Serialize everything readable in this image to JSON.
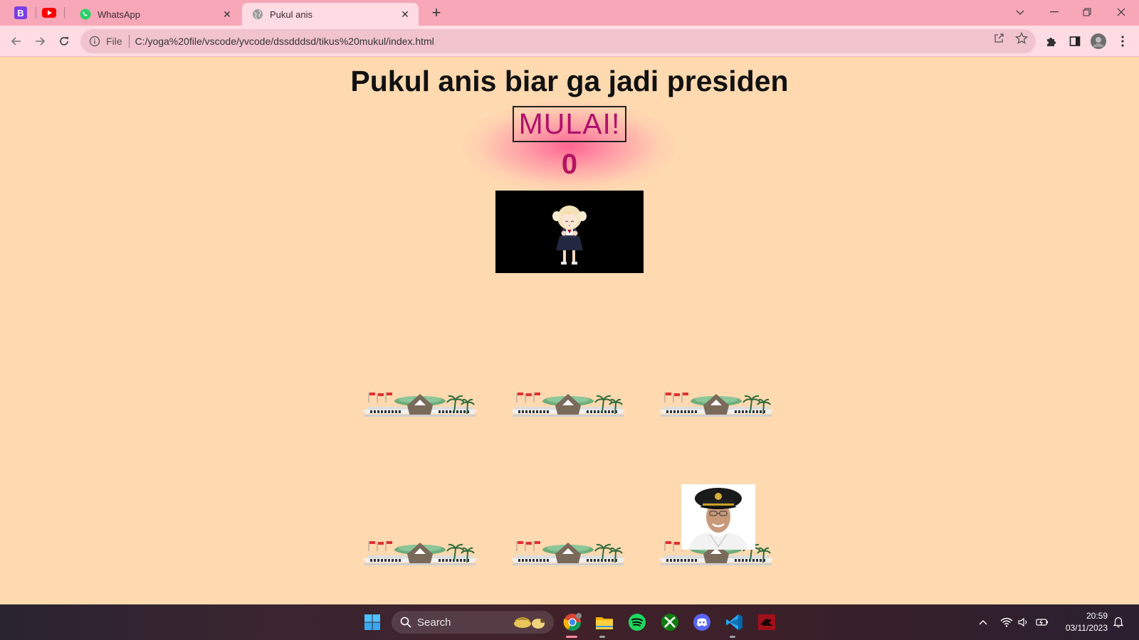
{
  "browser": {
    "pinned_tabs": [
      {
        "icon": "blogger-b-icon",
        "letter": "B",
        "color": "#7b3fe4"
      },
      {
        "icon": "youtube-icon",
        "color": "#ff0000"
      }
    ],
    "tabs": [
      {
        "title": "WhatsApp",
        "icon": "whatsapp-icon",
        "active": false
      },
      {
        "title": "Pukul anis",
        "icon": "globe-icon",
        "active": true
      }
    ],
    "address": {
      "scheme_label": "File",
      "url": "C:/yoga%20file/vscode/yvcode/dssdddsd/tikus%20mukul/index.html"
    }
  },
  "page": {
    "heading": "Pukul anis biar ga jadi presiden",
    "start_button": "MULAI!",
    "score": "0",
    "holes_count": 6,
    "mole_visible_in_hole": 6
  },
  "taskbar": {
    "search_label": "Search",
    "time": "20:59",
    "date": "03/11/2023",
    "apps": [
      "windows-start-icon",
      "chrome-icon",
      "file-explorer-icon",
      "spotify-icon",
      "xbox-icon",
      "discord-icon",
      "vscode-icon",
      "game-app-icon"
    ]
  },
  "colors": {
    "tabstrip": "#f7a7b8",
    "toolbar": "#ffdbe3",
    "page_bg": "#ffd9b0",
    "start_text": "#b0126b",
    "score_text": "#b3155f"
  }
}
